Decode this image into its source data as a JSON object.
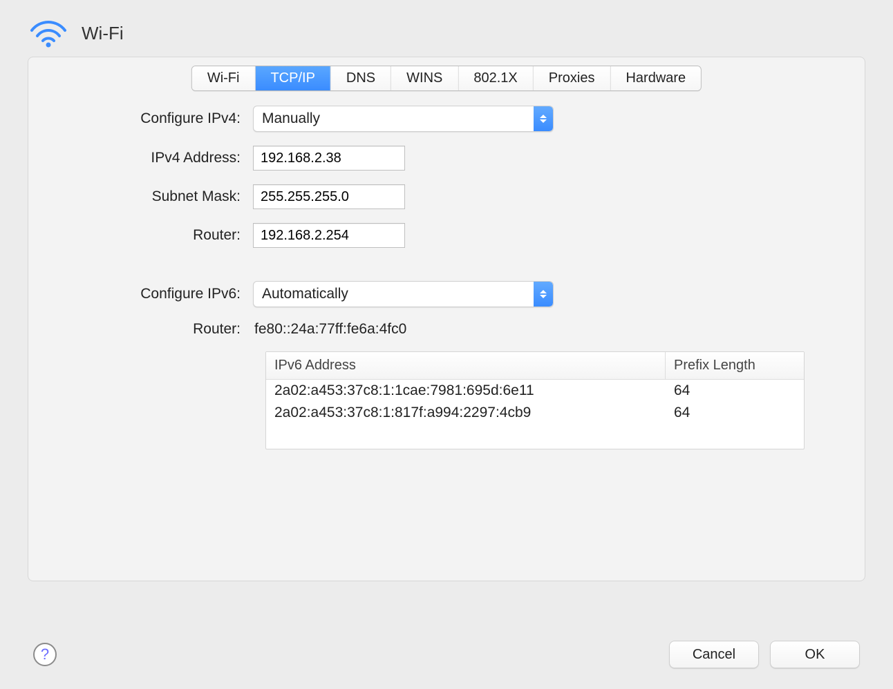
{
  "header": {
    "title": "Wi-Fi"
  },
  "tabs": {
    "items": [
      "Wi-Fi",
      "TCP/IP",
      "DNS",
      "WINS",
      "802.1X",
      "Proxies",
      "Hardware"
    ],
    "selected_index": 1
  },
  "ipv4": {
    "configure_label": "Configure IPv4:",
    "configure_value": "Manually",
    "address_label": "IPv4 Address:",
    "address_value": "192.168.2.38",
    "subnet_label": "Subnet Mask:",
    "subnet_value": "255.255.255.0",
    "router_label": "Router:",
    "router_value": "192.168.2.254"
  },
  "ipv6": {
    "configure_label": "Configure IPv6:",
    "configure_value": "Automatically",
    "router_label": "Router:",
    "router_value": "fe80::24a:77ff:fe6a:4fc0",
    "table": {
      "col_address": "IPv6 Address",
      "col_prefix": "Prefix Length",
      "rows": [
        {
          "address": "2a02:a453:37c8:1:1cae:7981:695d:6e11",
          "prefix": "64"
        },
        {
          "address": "2a02:a453:37c8:1:817f:a994:2297:4cb9",
          "prefix": "64"
        }
      ]
    }
  },
  "footer": {
    "help": "?",
    "cancel": "Cancel",
    "ok": "OK"
  }
}
